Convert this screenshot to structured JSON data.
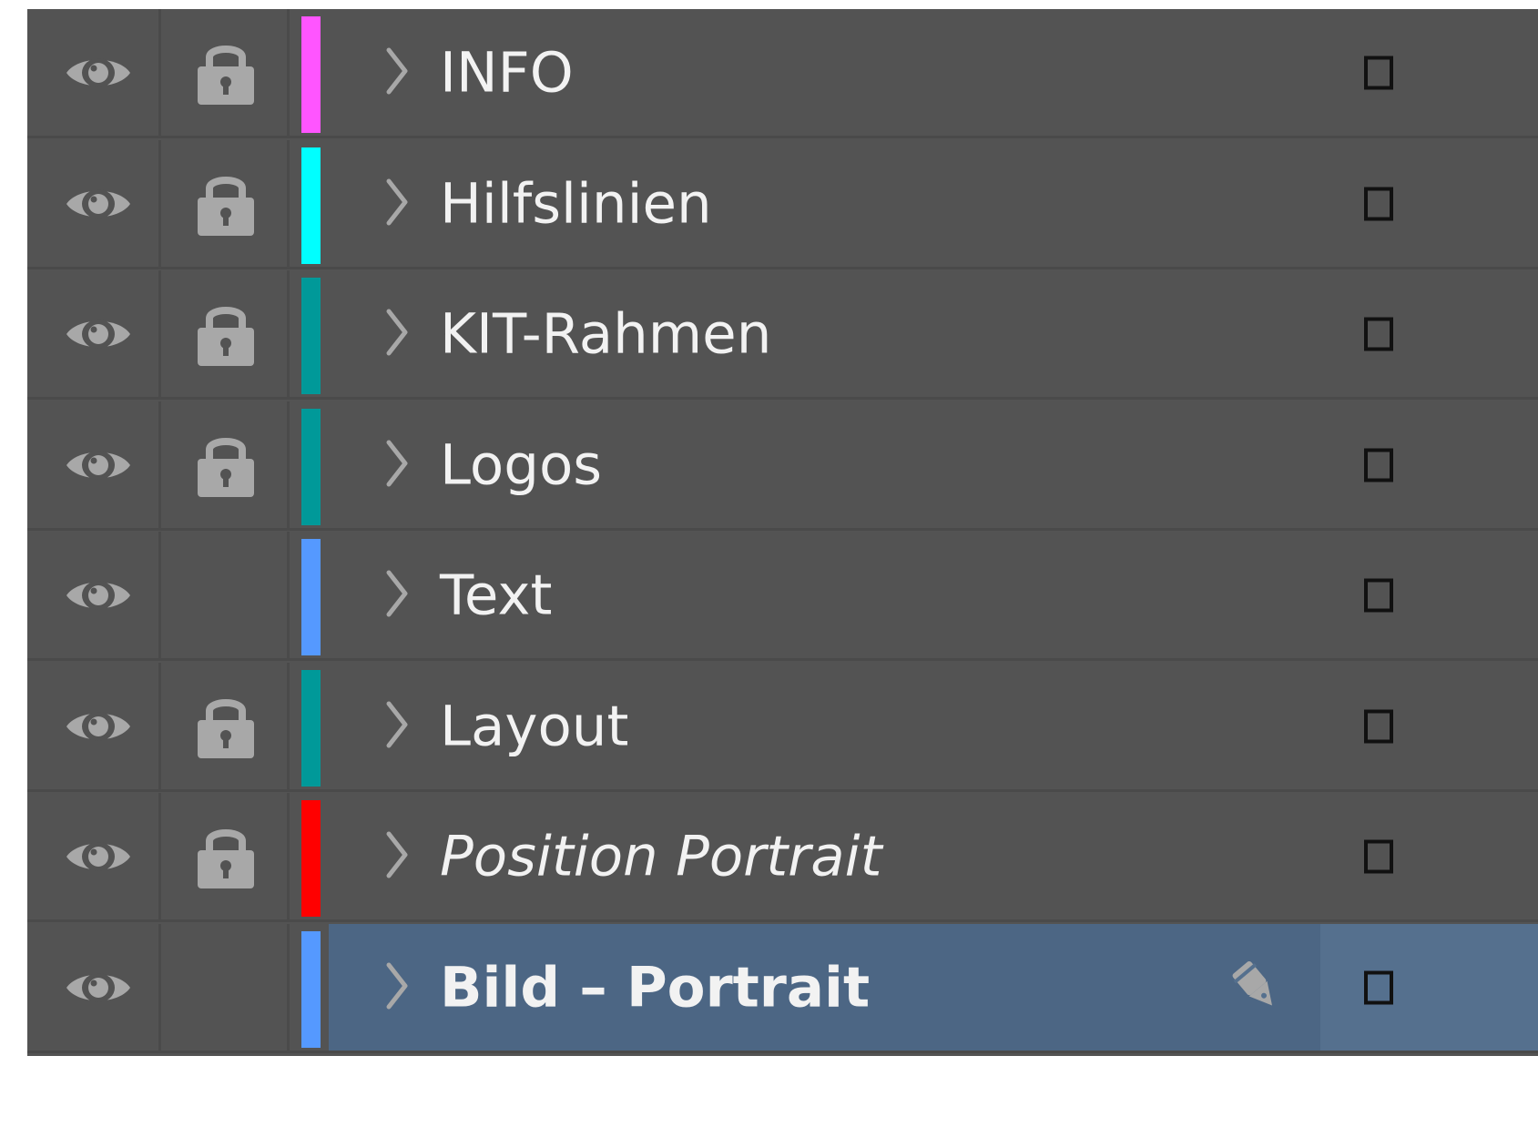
{
  "panel": {
    "rows": [
      {
        "name": "INFO",
        "color": "#ff55ff",
        "visible": true,
        "locked": true,
        "italic": false,
        "selected": false,
        "pen": false
      },
      {
        "name": "Hilfslinien",
        "color": "#00ffff",
        "visible": true,
        "locked": true,
        "italic": false,
        "selected": false,
        "pen": false
      },
      {
        "name": "KIT-Rahmen",
        "color": "#009999",
        "visible": true,
        "locked": true,
        "italic": false,
        "selected": false,
        "pen": false
      },
      {
        "name": "Logos",
        "color": "#009999",
        "visible": true,
        "locked": true,
        "italic": false,
        "selected": false,
        "pen": false
      },
      {
        "name": "Text",
        "color": "#5599ff",
        "visible": true,
        "locked": false,
        "italic": false,
        "selected": false,
        "pen": false
      },
      {
        "name": "Layout",
        "color": "#009999",
        "visible": true,
        "locked": true,
        "italic": false,
        "selected": false,
        "pen": false
      },
      {
        "name": "Position Portrait",
        "color": "#ff0000",
        "visible": true,
        "locked": true,
        "italic": true,
        "selected": false,
        "pen": false
      },
      {
        "name": "Bild – Portrait",
        "color": "#5599ff",
        "visible": true,
        "locked": false,
        "italic": false,
        "selected": true,
        "pen": true
      }
    ],
    "icons": {
      "visibility": "eye-icon",
      "lock": "lock-icon",
      "expand": "chevron-right-icon",
      "current_drawing_layer": "pen-icon",
      "target": "square-target-icon"
    },
    "colors": {
      "panel_bg": "#535353",
      "selected_bg": "#4c6684",
      "text": "#f2f2f2",
      "icon": "#a8a8a8"
    }
  }
}
